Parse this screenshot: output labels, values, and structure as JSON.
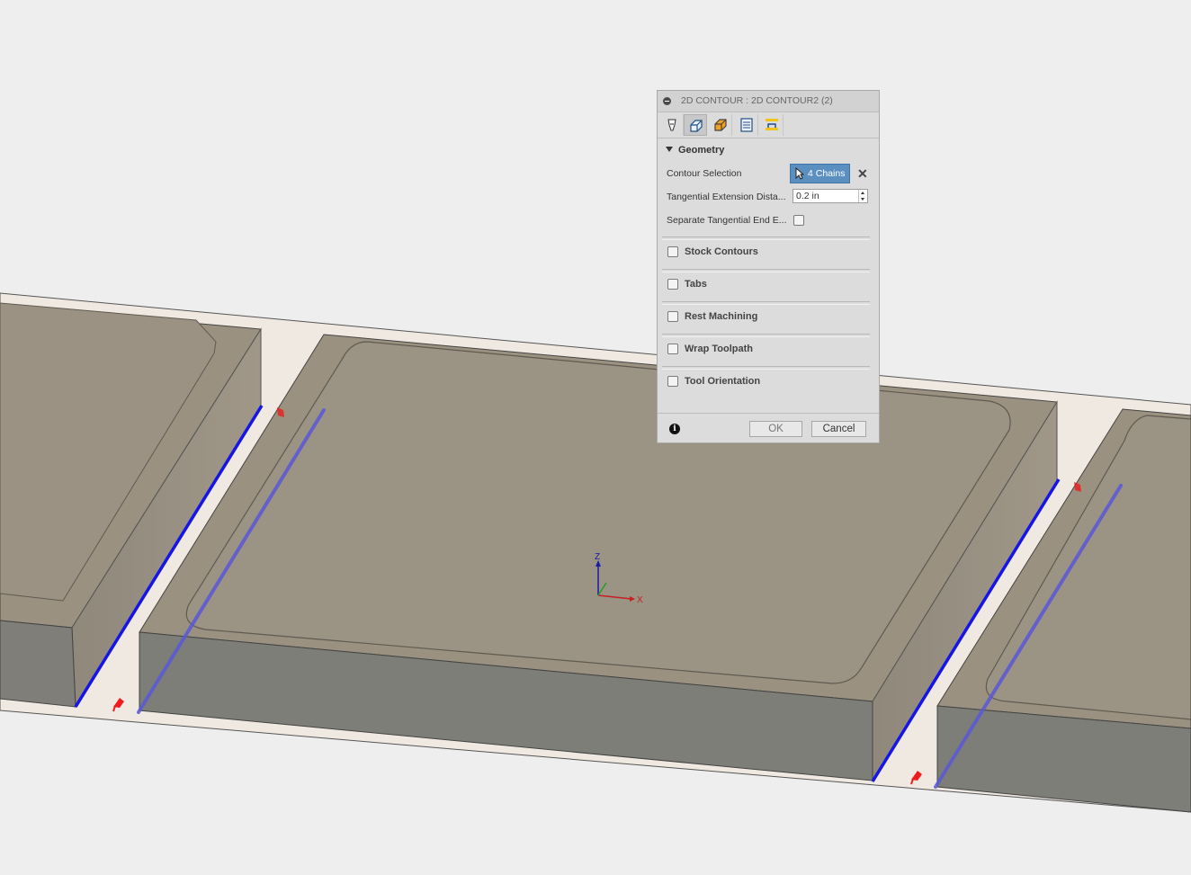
{
  "dialog": {
    "title": "2D CONTOUR : 2D CONTOUR2 (2)",
    "tabs": [
      {
        "name": "tool-tab-icon"
      },
      {
        "name": "geometry-tab-icon"
      },
      {
        "name": "heights-tab-icon"
      },
      {
        "name": "passes-tab-icon"
      },
      {
        "name": "linking-tab-icon"
      }
    ],
    "active_tab": 1,
    "geometry": {
      "header": "Geometry",
      "contour_selection_label": "Contour Selection",
      "contour_selection_value": "4 Chains",
      "tangential_extension_label": "Tangential Extension Dista...",
      "tangential_extension_value": "0.2 in",
      "separate_tangential_label": "Separate Tangential End E...",
      "separate_tangential_checked": false
    },
    "groups": [
      {
        "label": "Stock Contours",
        "checked": false
      },
      {
        "label": "Tabs",
        "checked": false
      },
      {
        "label": "Rest Machining",
        "checked": false
      },
      {
        "label": "Wrap Toolpath",
        "checked": false
      },
      {
        "label": "Tool Orientation",
        "checked": false
      }
    ],
    "buttons": {
      "ok": "OK",
      "cancel": "Cancel"
    }
  },
  "viewport": {
    "axes": {
      "z": "Z",
      "x": "X"
    }
  },
  "colors": {
    "selected_chain": "#1515e6",
    "toolpath_preview": "#5a58d8",
    "entry_marker": "#ee1c1c",
    "part_top": "#9a9180",
    "part_side": "#7e7e78",
    "stock": "#f0e9e1",
    "selection_button": "#5b8fc0"
  }
}
